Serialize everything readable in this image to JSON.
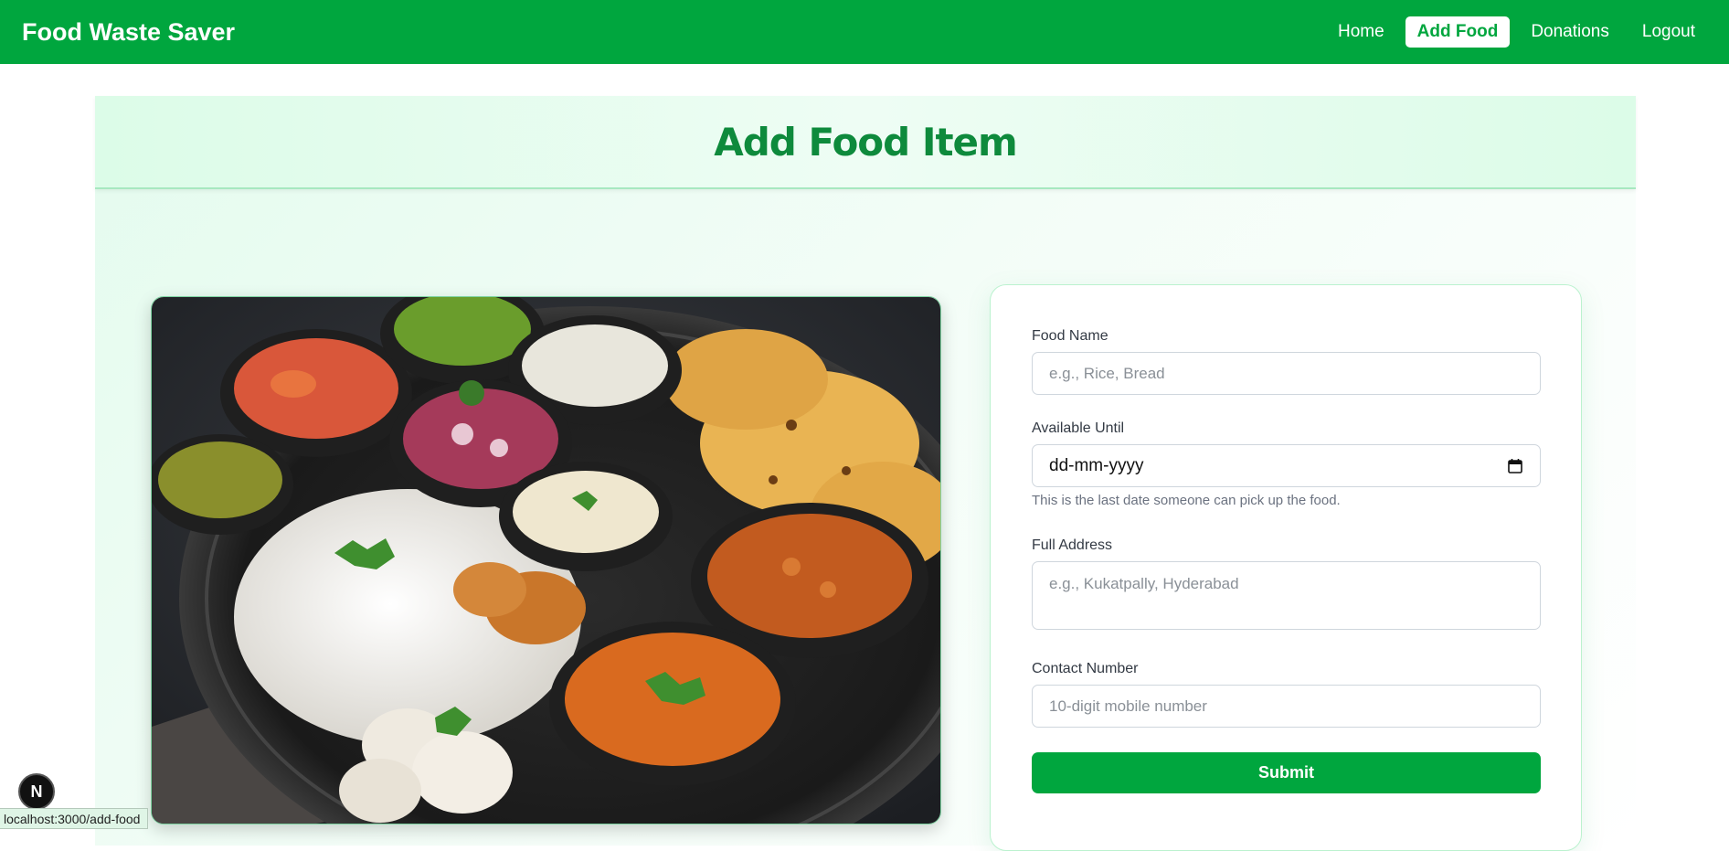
{
  "navbar": {
    "brand": "Food Waste Saver",
    "links": [
      {
        "label": "Home",
        "active": false
      },
      {
        "label": "Add Food",
        "active": true
      },
      {
        "label": "Donations",
        "active": false
      },
      {
        "label": "Logout",
        "active": false
      }
    ]
  },
  "page": {
    "title": "Add Food Item"
  },
  "form": {
    "food_name": {
      "label": "Food Name",
      "placeholder": "e.g., Rice, Bread"
    },
    "available_until": {
      "label": "Available Until",
      "value": "dd-mm-yyyy",
      "hint": "This is the last date someone can pick up the food."
    },
    "full_address": {
      "label": "Full Address",
      "placeholder": "e.g., Kukatpally, Hyderabad"
    },
    "contact_number": {
      "label": "Contact Number",
      "placeholder": "10-digit mobile number"
    },
    "submit_label": "Submit"
  },
  "image": {
    "alt": "Indian thali food platter"
  },
  "dev_badge": {
    "letter": "N"
  },
  "status_bar": {
    "url": "localhost:3000/add-food"
  },
  "colors": {
    "accent": "#00a63e",
    "title_green": "#0e8a3c"
  }
}
